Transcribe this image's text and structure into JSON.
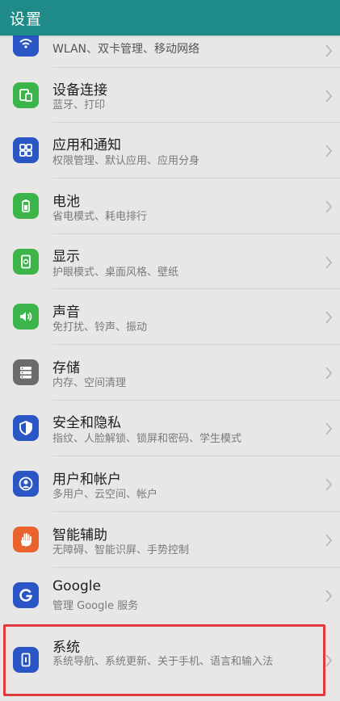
{
  "header": {
    "title": "设置"
  },
  "items": [
    {
      "title": "",
      "sub": "WLAN、双卡管理、移动网络",
      "icon": "wifi-icon",
      "color": "#2a56c6"
    },
    {
      "title": "设备连接",
      "sub": "蓝牙、打印",
      "icon": "device-connection-icon",
      "color": "#3bb44a"
    },
    {
      "title": "应用和通知",
      "sub": "权限管理、默认应用、应用分身",
      "icon": "apps-icon",
      "color": "#2a56c6"
    },
    {
      "title": "电池",
      "sub": "省电模式、耗电排行",
      "icon": "battery-icon",
      "color": "#3bb44a"
    },
    {
      "title": "显示",
      "sub": "护眼模式、桌面风格、壁纸",
      "icon": "display-icon",
      "color": "#3bb44a"
    },
    {
      "title": "声音",
      "sub": "免打扰、铃声、振动",
      "icon": "sound-icon",
      "color": "#3bb44a"
    },
    {
      "title": "存储",
      "sub": "内存、空间清理",
      "icon": "storage-icon",
      "color": "#6b6b6b"
    },
    {
      "title": "安全和隐私",
      "sub": "指纹、人脸解锁、锁屏和密码、学生模式",
      "icon": "shield-icon",
      "color": "#2a56c6"
    },
    {
      "title": "用户和帐户",
      "sub": "多用户、云空间、帐户",
      "icon": "user-icon",
      "color": "#2a56c6"
    },
    {
      "title": "智能辅助",
      "sub": "无障碍、智能识屏、手势控制",
      "icon": "hand-icon",
      "color": "#e8632e"
    },
    {
      "title": "Google",
      "sub": "管理 Google 服务",
      "icon": "google-icon",
      "color": "#2a56c6"
    },
    {
      "title": "系统",
      "sub": "系统导航、系统更新、关于手机、语言和输入法",
      "icon": "system-phone-icon",
      "color": "#2a56c6"
    }
  ]
}
